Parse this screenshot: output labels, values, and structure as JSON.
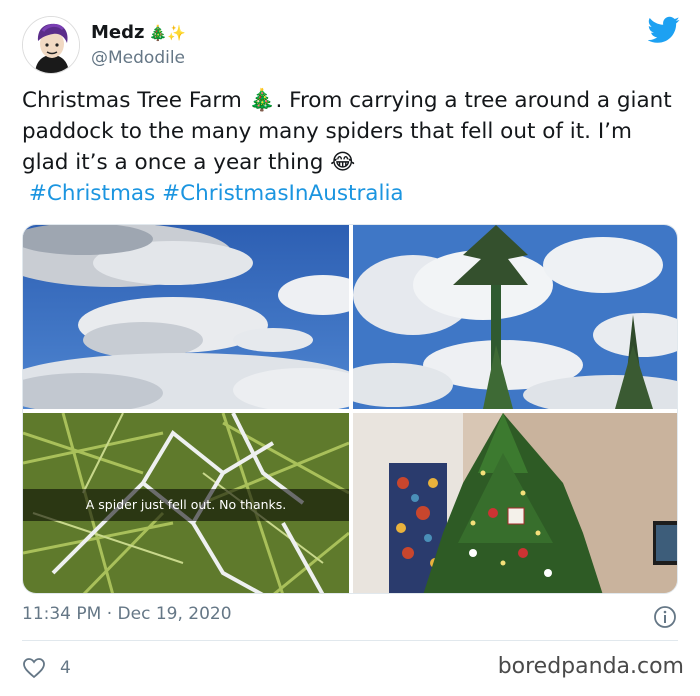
{
  "user": {
    "name": "Medz",
    "name_emoji": "🎄✨",
    "handle": "@Medodile"
  },
  "tweet": {
    "text_before_emoji": "Christmas Tree Farm ",
    "emoji_tree": "🎄",
    "text_after_emoji": ". From carrying a tree around a giant paddock to the many many spiders that fell out of it. I’m glad it’s a once a year thing ",
    "emoji_laugh": "😂",
    "hashtags": [
      "#Christmas",
      "#ChristmasInAustralia"
    ]
  },
  "media": {
    "caption": "A spider just fell out. No thanks."
  },
  "timestamp": "11:34 PM · Dec 19, 2020",
  "likes": {
    "count": "4"
  },
  "watermark": "boredpanda.com",
  "colors": {
    "text": "#14171a",
    "muted": "#657786",
    "link": "#1b95e0",
    "twitter_blue": "#1da1f2",
    "divider": "#e1e8ed"
  },
  "icons": {
    "brand": "twitter-bird-icon",
    "info": "info-icon",
    "like": "heart-icon"
  }
}
